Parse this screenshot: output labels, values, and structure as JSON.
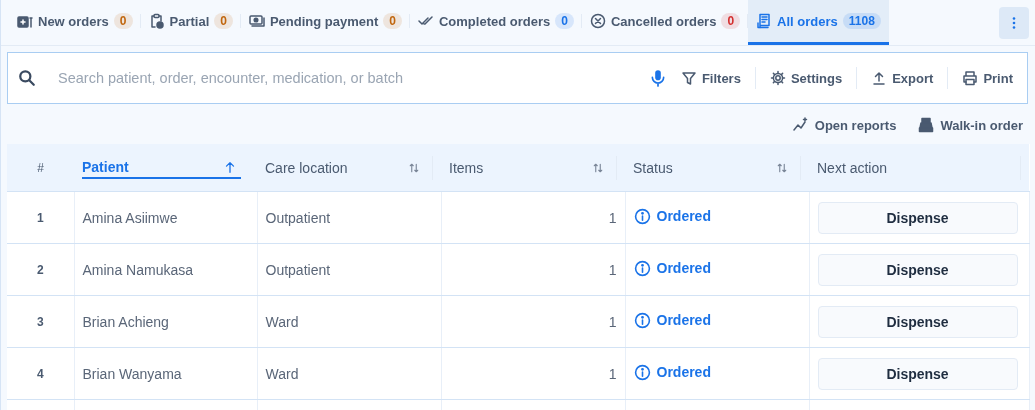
{
  "tabs": [
    {
      "label": "New orders",
      "count": "0",
      "color": "#c0660e",
      "selected": false
    },
    {
      "label": "Partial",
      "count": "0",
      "color": "#c0660e",
      "selected": false
    },
    {
      "label": "Pending payment",
      "count": "0",
      "color": "#c0660e",
      "selected": false
    },
    {
      "label": "Completed orders",
      "count": "0",
      "color": "#1a73e8",
      "selected": false
    },
    {
      "label": "Cancelled orders",
      "count": "0",
      "color": "#d32f2f",
      "selected": false
    },
    {
      "label": "All orders",
      "count": "1108",
      "color": "#1a73e8",
      "selected": true
    }
  ],
  "search": {
    "placeholder": "Search patient, order, encounter, medication, or batch"
  },
  "toolbar": [
    "Filters",
    "Settings",
    "Export",
    "Print"
  ],
  "actions": [
    "Open reports",
    "Walk-in order"
  ],
  "table": {
    "columns": [
      {
        "label": "#"
      },
      {
        "label": "Patient",
        "sorted": true
      },
      {
        "label": "Care location",
        "sorted": false
      },
      {
        "label": "Items",
        "sorted": false
      },
      {
        "label": "Status",
        "sorted": false
      },
      {
        "label": "Next action"
      }
    ],
    "rows": [
      {
        "index": "1",
        "patient": "Amina Asiimwe",
        "location": "Outpatient",
        "items": "1",
        "status": "Ordered",
        "action": "Dispense"
      },
      {
        "index": "2",
        "patient": "Amina Namukasa",
        "location": "Outpatient",
        "items": "1",
        "status": "Ordered",
        "action": "Dispense"
      },
      {
        "index": "3",
        "patient": "Brian Achieng",
        "location": "Ward",
        "items": "1",
        "status": "Ordered",
        "action": "Dispense"
      },
      {
        "index": "4",
        "patient": "Brian Wanyama",
        "location": "Ward",
        "items": "1",
        "status": "Ordered",
        "action": "Dispense"
      }
    ]
  }
}
